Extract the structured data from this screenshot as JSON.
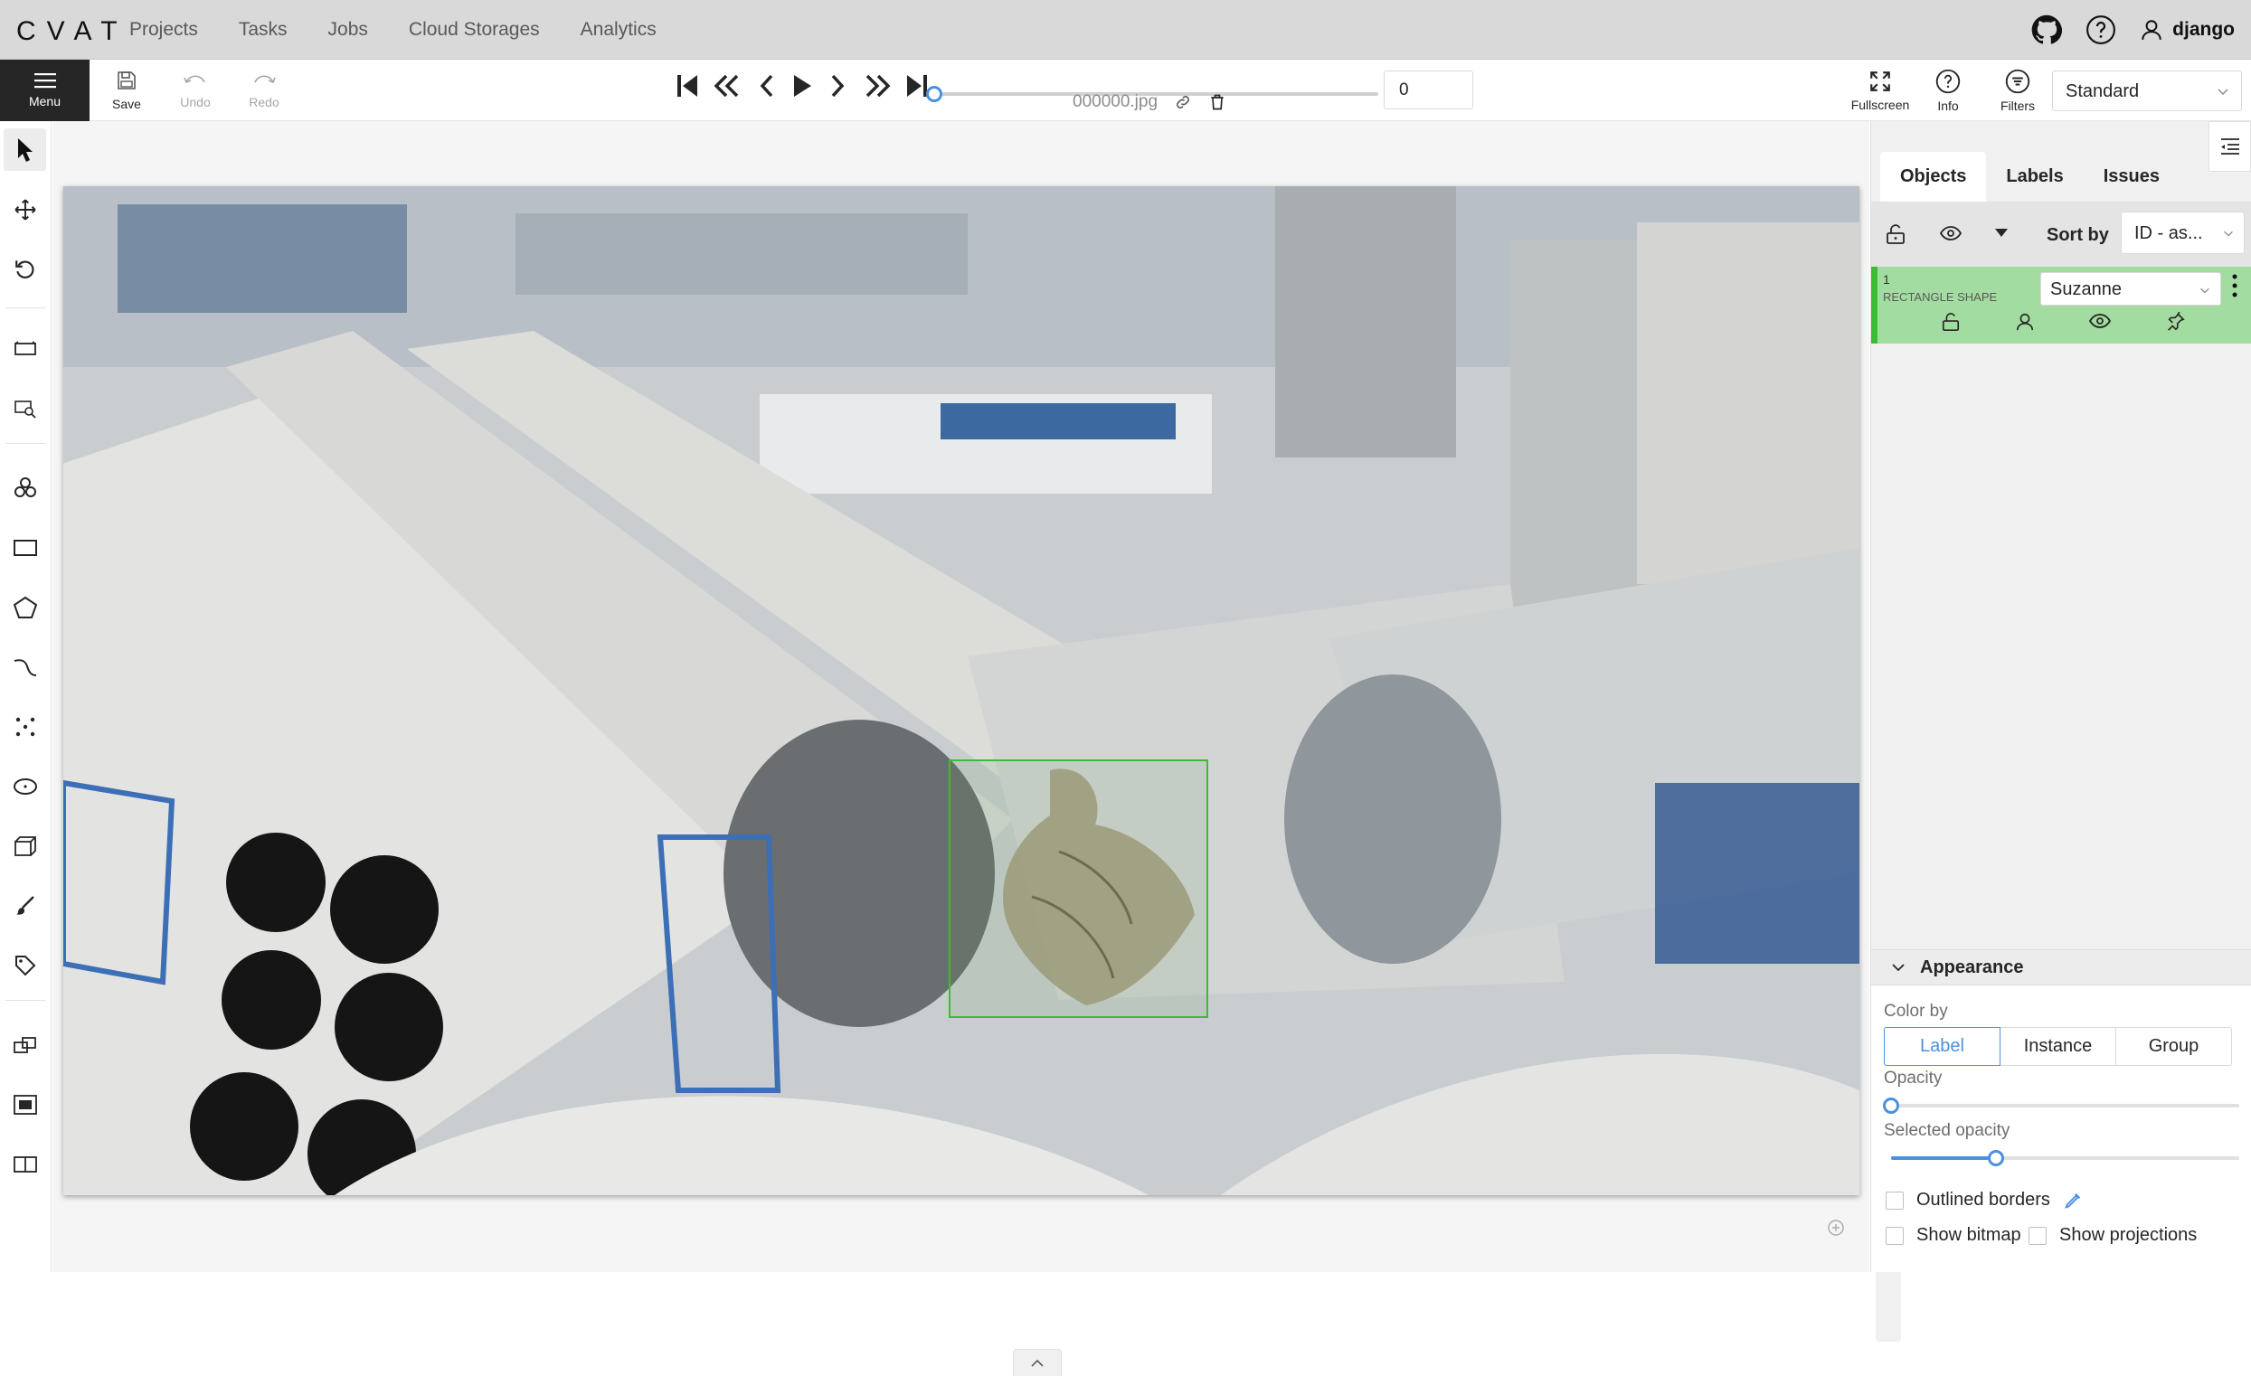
{
  "app": {
    "logo": "CVAT"
  },
  "nav": {
    "links": [
      "Projects",
      "Tasks",
      "Jobs",
      "Cloud Storages",
      "Analytics"
    ]
  },
  "user": {
    "name": "django"
  },
  "toolbar": {
    "menu_label": "Menu",
    "save_label": "Save",
    "undo_label": "Undo",
    "redo_label": "Redo",
    "filename": "000000.jpg",
    "frame_number": "0",
    "fullscreen_label": "Fullscreen",
    "info_label": "Info",
    "filters_label": "Filters",
    "workspace": "Standard"
  },
  "frame_progress": 0,
  "sidebar": {
    "tabs": [
      "Objects",
      "Labels",
      "Issues"
    ],
    "active_tab": "Objects",
    "sort_label": "Sort by",
    "sort_value": "ID - as...",
    "objects": [
      {
        "id": "1",
        "type": "RECTANGLE SHAPE",
        "label": "Suzanne",
        "color": "#3bbd33"
      }
    ]
  },
  "appearance": {
    "title": "Appearance",
    "color_by_label": "Color by",
    "color_by_options": [
      "Label",
      "Instance",
      "Group"
    ],
    "color_by_selected": "Label",
    "opacity_label": "Opacity",
    "opacity": 0,
    "selected_opacity_label": "Selected opacity",
    "selected_opacity": 0.3,
    "outlined_borders_label": "Outlined borders",
    "show_bitmap_label": "Show bitmap",
    "show_projections_label": "Show projections"
  },
  "colors": {
    "accent": "#4a90e2",
    "shape": "#3bbd33",
    "menu_bg": "#262626"
  }
}
